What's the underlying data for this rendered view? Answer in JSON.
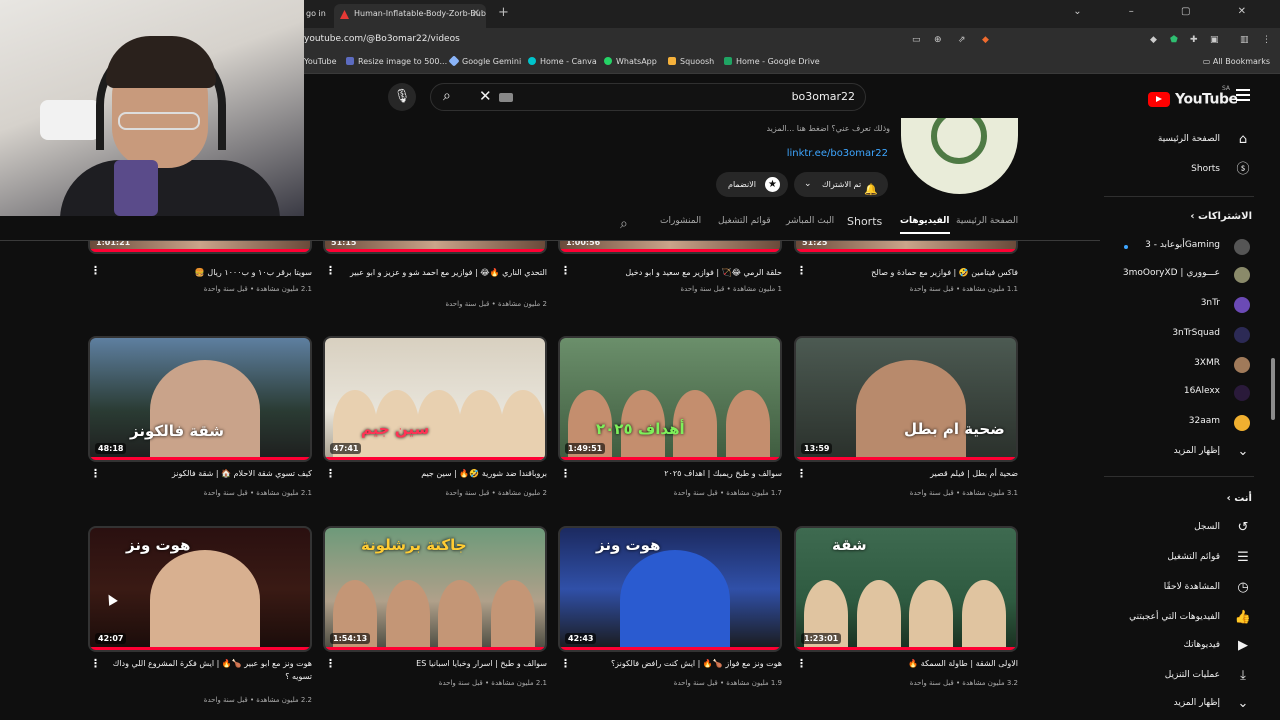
{
  "browser": {
    "tab1_label": "go in",
    "tab2_label": "Human-Inflatable-Body-Zorb-Bubble",
    "new_tab": "+",
    "url": "youtube.com/@Bo3omar22/videos",
    "bookmarks": [
      "YouTube",
      "Resize image to 500...",
      "Google Gemini",
      "Home - Canva",
      "WhatsApp",
      "Squoosh",
      "Home - Google Drive"
    ],
    "all_bookmarks": "All Bookmarks"
  },
  "search": {
    "query": "bo3omar22"
  },
  "channel": {
    "about": "وذلك تعرف عني؟ اضغط هنا ...المزيد",
    "link": "linktr.ee/bo3omar22",
    "subscribe_label": "تم الاشتراك",
    "join_label": "الانضمام",
    "tabs": [
      "الصفحة الرئيسية",
      "الفيديوهات",
      "Shorts",
      "البث المباشر",
      "قوائم التشغيل",
      "المنشورات"
    ]
  },
  "sidebar": {
    "logo_text": "YouTube",
    "region": "SA",
    "main": [
      {
        "label": "الصفحة الرئيسية",
        "icon": "home-icon"
      },
      {
        "label": "Shorts",
        "icon": "shorts-icon"
      }
    ],
    "subs_title": "الاشتراكات",
    "subs": [
      {
        "label": "أبوعابد - 3Gaming",
        "color": "#555555",
        "dot": true
      },
      {
        "label": "3moOoryXD | عـــووري",
        "color": "#8a8a6a",
        "dot": false
      },
      {
        "label": "3nTr",
        "color": "#6b4ab5",
        "dot": false
      },
      {
        "label": "3nTrSquad",
        "color": "#2c2a55",
        "dot": false
      },
      {
        "label": "3XMR",
        "color": "#a07a5a",
        "dot": false
      },
      {
        "label": "16Alexx",
        "color": "#2a1a3a",
        "dot": false
      },
      {
        "label": "32aam",
        "color": "#f0b030",
        "dot": false
      }
    ],
    "show_more": "إظهار المزيد",
    "you_title": "أنت",
    "you": [
      {
        "label": "السجل",
        "icon": "history-icon"
      },
      {
        "label": "قوائم التشغيل",
        "icon": "playlists-icon"
      },
      {
        "label": "المشاهدة لاحقًا",
        "icon": "watch-later-icon"
      },
      {
        "label": "الفيديوهات التي أعجبتني",
        "icon": "liked-icon"
      },
      {
        "label": "فيديوهاتك",
        "icon": "your-videos-icon"
      },
      {
        "label": "عمليات التنزيل",
        "icon": "downloads-icon"
      },
      {
        "label": "إظهار المزيد",
        "icon": "chevron-down-icon"
      }
    ]
  },
  "videos_row0": [
    {
      "duration": "1:01:21",
      "title": "سويتا برقر ب١٠ و ب١٠٠٠ ريال 🍔",
      "meta": "2.1 مليون مشاهدة • قبل سنة واحدة"
    },
    {
      "duration": "51:15",
      "title": "التحدي الناري 🔥😂 | فوازير مع احمد شو و عزيز و ابو عبير",
      "meta": "2 مليون مشاهدة • قبل سنة واحدة"
    },
    {
      "duration": "1:00:56",
      "title": "حلقة الرمي 😂🏹 | فوازير مع سعيد و ابو دخيل",
      "meta": "1 مليون مشاهدة • قبل سنة واحدة"
    },
    {
      "duration": "51:25",
      "title": "فاكس فيتامين 🤣 | فوازير مع حمادة و صالح",
      "meta": "1.1 مليون مشاهدة • قبل سنة واحدة"
    }
  ],
  "videos_row1": [
    {
      "duration": "48:18",
      "title": "كيف تسوي شقة الاحلام 🏠 | شقة فالكونز",
      "meta": "2.1 مليون مشاهدة • قبل سنة واحدة"
    },
    {
      "duration": "47:41",
      "title": "بروباقندا ضد شورية 🤣🔥 | سين جيم",
      "meta": "2 مليون مشاهدة • قبل سنة واحدة"
    },
    {
      "duration": "1:49:51",
      "title": "سوالف و طبخ ريمبك | اهداف ٢٠٢٥",
      "meta": "1.7 مليون مشاهدة • قبل سنة واحدة"
    },
    {
      "duration": "13:59",
      "title": "ضحية أم بطل | فيلم قصير",
      "meta": "3.1 مليون مشاهدة • قبل سنة واحدة"
    }
  ],
  "videos_row2": [
    {
      "duration": "42:07",
      "title": "هوت ونز مع ابو عبير 🍗🔥 | ايش فكرة المشروع اللي وداك تسويه ؟",
      "meta": "2.2 مليون مشاهدة • قبل سنة واحدة"
    },
    {
      "duration": "1:54:13",
      "title": "سوالف و طبخ | اسرار وخبايا اسبانيا ES",
      "meta": "2.1 مليون مشاهدة • قبل سنة واحدة"
    },
    {
      "duration": "42:43",
      "title": "هوت ونز مع فواز 🍗🔥 | ايش كنت رافض فالكونز؟",
      "meta": "1.9 مليون مشاهدة • قبل سنة واحدة"
    },
    {
      "duration": "1:23:01",
      "title": "الاولى الشقة | طاولة السمكة 🔥",
      "meta": "3.2 مليون مشاهدة • قبل سنة واحدة"
    }
  ],
  "thumb_overlays": {
    "r1c0": "شقة فالكونز",
    "r1c1": "سين جيم",
    "r1c2": "أهداف ٢٠٢٥",
    "r1c3": "ضحية ام بطل",
    "r2c0": "هوت ونز",
    "r2c1": "جاكتة برشلونة",
    "r2c2": "هوت ونز",
    "r2c3": "شقة"
  }
}
